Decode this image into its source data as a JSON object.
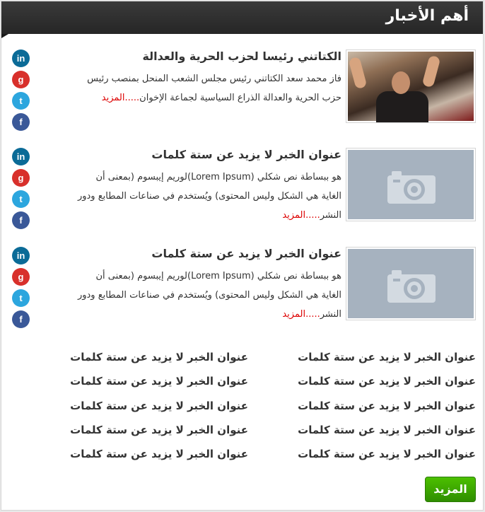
{
  "header": {
    "title": "أهم الأخبار"
  },
  "news": [
    {
      "title": "الكتاتني رئيسا لحزب الحرية والعدالة",
      "body": "فاز محمد سعد الكتاتني رئيس مجلس الشعب المنحل بمنصب رئيس حزب الحرية والعدالة الذراع السياسية لجماعة الإخوان",
      "more": ".....المزيد",
      "image": "photo"
    },
    {
      "title": "عنوان الخبر لا يزيد عن ستة كلمات",
      "body": "هو ببساطة نص شكلي (Lorem Ipsum)لوريم إيبسوم (بمعنى أن الغاية هي الشكل وليس المحتوى) ويُستخدم في صناعات المطابع ودور النشر",
      "more": ".....المزيد",
      "image": "placeholder"
    },
    {
      "title": "عنوان الخبر لا يزيد عن ستة كلمات",
      "body": "هو ببساطة نص شكلي (Lorem Ipsum)لوريم إيبسوم (بمعنى أن الغاية هي الشكل وليس المحتوى) ويُستخدم في صناعات المطابع ودور النشر",
      "more": ".....المزيد",
      "image": "placeholder"
    }
  ],
  "social_icons": [
    "linkedin-icon",
    "google-icon",
    "twitter-icon",
    "facebook-icon"
  ],
  "social_glyphs": {
    "linkedin": "in",
    "google": "g",
    "twitter": "t",
    "facebook": "f"
  },
  "headlines": [
    "عنوان الخبر لا يزيد عن ستة كلمات",
    "عنوان الخبر لا يزيد عن ستة كلمات",
    "عنوان الخبر لا يزيد عن ستة كلمات",
    "عنوان الخبر لا يزيد عن ستة كلمات",
    "عنوان الخبر لا يزيد عن ستة كلمات",
    "عنوان الخبر لا يزيد عن ستة كلمات",
    "عنوان الخبر لا يزيد عن ستة كلمات",
    "عنوان الخبر لا يزيد عن ستة كلمات",
    "عنوان الخبر لا يزيد عن ستة كلمات",
    "عنوان الخبر لا يزيد عن ستة كلمات"
  ],
  "more_button": "المزيد",
  "colors": {
    "header_bg": "#2f2f2f",
    "link_red": "#dd0000",
    "button_green": "#3aa500"
  }
}
